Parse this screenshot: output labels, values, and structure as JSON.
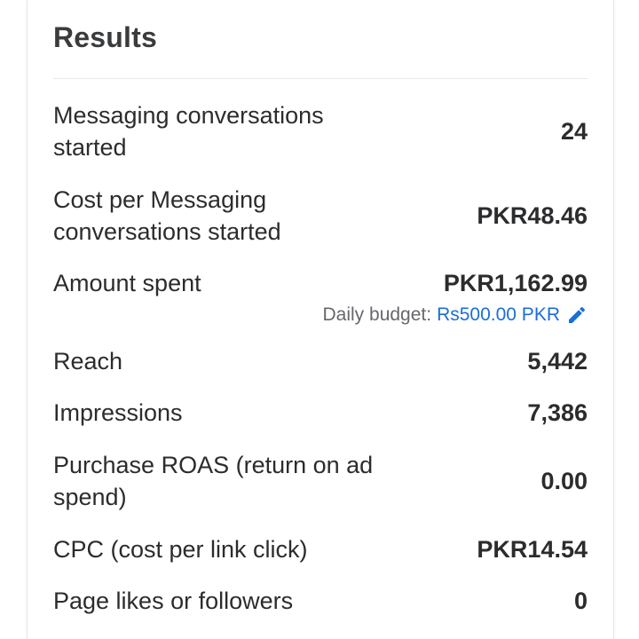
{
  "section": {
    "title": "Results"
  },
  "metrics": [
    {
      "label": "Messaging conversations\nstarted",
      "value": "24"
    },
    {
      "label": "Cost per Messaging\nconversations started",
      "value": "PKR48.46"
    },
    {
      "label": "Amount spent",
      "value": "PKR1,162.99"
    },
    {
      "label": "Reach",
      "value": "5,442"
    },
    {
      "label": "Impressions",
      "value": "7,386"
    },
    {
      "label": "Purchase ROAS (return on ad\nspend)",
      "value": "0.00"
    },
    {
      "label": "CPC (cost per link click)",
      "value": "PKR14.54"
    },
    {
      "label": "Page likes or followers",
      "value": "0"
    }
  ],
  "budget": {
    "label": "Daily budget:",
    "value": "Rs500.00 PKR",
    "icon": "pencil-icon"
  },
  "colors": {
    "text": "#2b2c2e",
    "secondary_text": "#65676b",
    "link": "#1a6ed8"
  }
}
